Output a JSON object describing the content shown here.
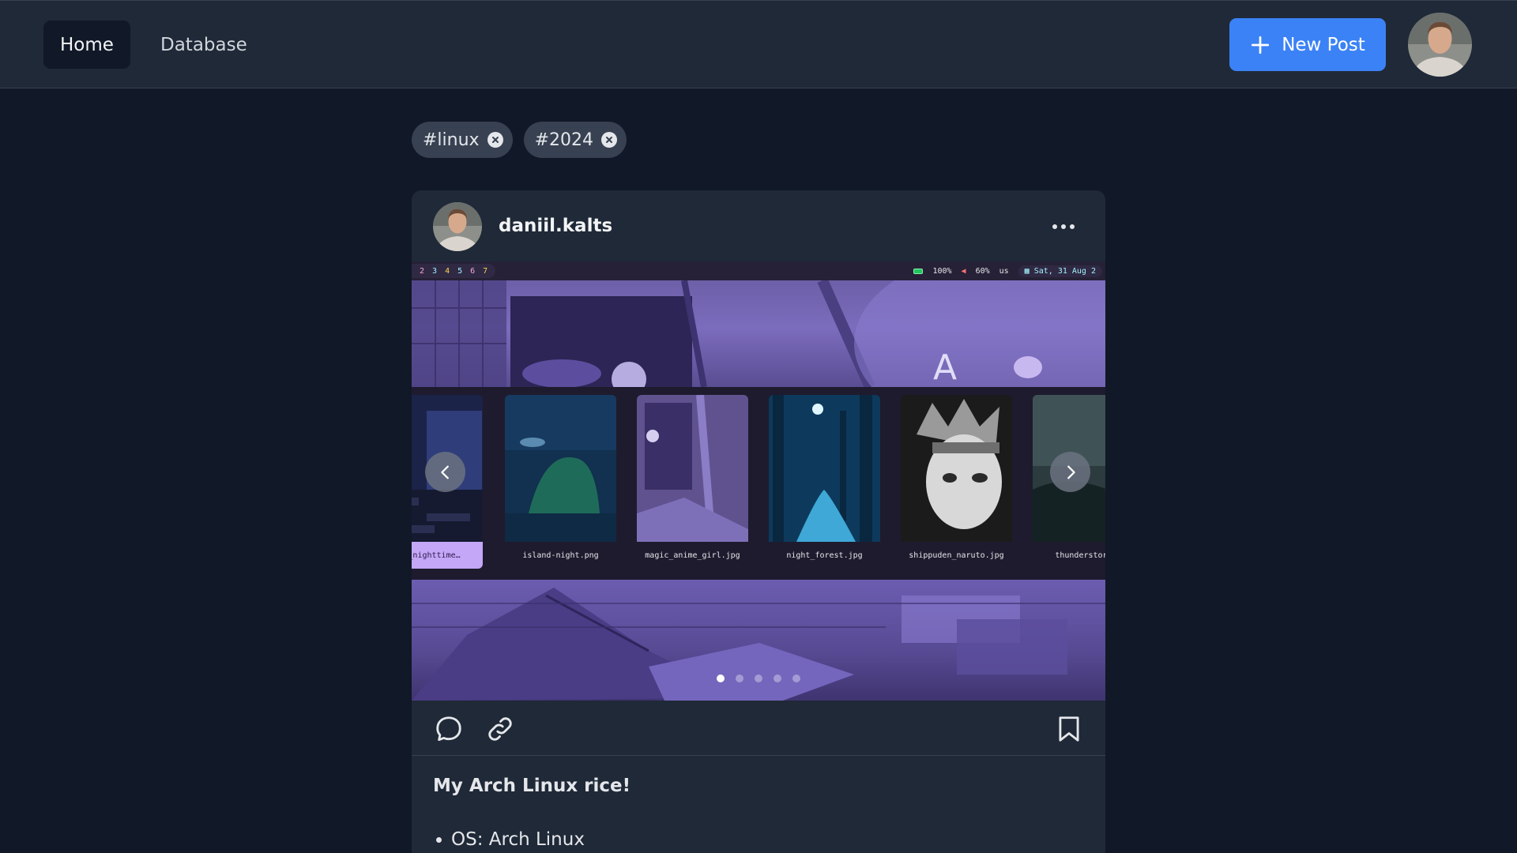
{
  "nav": {
    "home_label": "Home",
    "database_label": "Database",
    "new_post_label": "New Post"
  },
  "filters": {
    "tags": [
      "#linux",
      "#2024"
    ]
  },
  "post": {
    "username": "daniil.kalts",
    "title": "My Arch Linux rice!",
    "specs": [
      "OS: Arch Linux"
    ],
    "carousel": {
      "slide_count": 5,
      "active_slide": 1
    },
    "screenshot": {
      "workspaces": [
        "2",
        "3",
        "4",
        "5",
        "6",
        "7"
      ],
      "battery": "100%",
      "volume": "60%",
      "keyboard_layout": "us",
      "date": "Sat, 31 Aug 2",
      "thumbnails": [
        {
          "label": "oom_nighttime…",
          "selected": true
        },
        {
          "label": "island-night.png",
          "selected": false
        },
        {
          "label": "magic_anime_girl.jpg",
          "selected": false
        },
        {
          "label": "night_forest.jpg",
          "selected": false
        },
        {
          "label": "shippuden_naruto.jpg",
          "selected": false
        },
        {
          "label": "thunderstorm-s",
          "selected": false
        }
      ]
    }
  },
  "colors": {
    "background": "#111827",
    "surface": "#1f2937",
    "accent": "#3b82f6",
    "chip": "#374151",
    "selected_thumb": "#c4a7f7"
  },
  "icons": {
    "new_post": "plus-icon",
    "chip_remove": "close-circle-icon",
    "more": "more-horizontal-icon",
    "prev": "chevron-left-icon",
    "next": "chevron-right-icon",
    "comment": "comment-icon",
    "link": "link-icon",
    "bookmark": "bookmark-icon"
  }
}
